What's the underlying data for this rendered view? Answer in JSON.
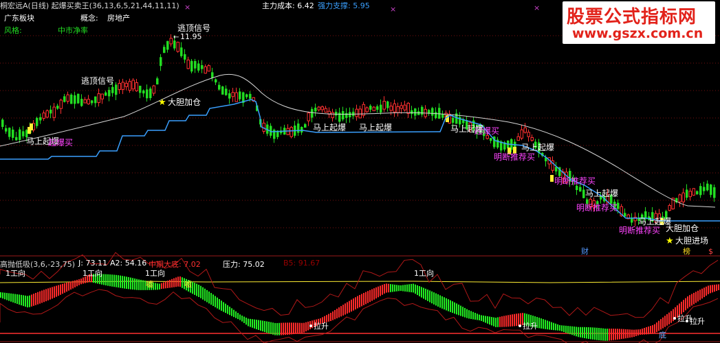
{
  "header": {
    "title": "桐宏远A(日线) 起爆买卖王(36,13,6,5,21,44,11,11)",
    "cost_label": "主力成本: 6.42",
    "support_label": "强力支撑: 5.95",
    "sector": "广东板块",
    "concept_label": "概念:",
    "concept_value": "房地产",
    "style_label": "风格:",
    "style_value": "中市净率"
  },
  "watermark": {
    "line1": "股票公式指标网",
    "line2": "www.gszx.com.cn"
  },
  "lower_header": {
    "name": "高抛低吸(3,6,-23,75)",
    "j": "J: 73.11",
    "a2": "A2: 54.16",
    "mid": "中期大底: 7.02",
    "pressure": "压力: 75.02",
    "b5": "B5: 91.67"
  },
  "colors": {
    "up": "#ff3030",
    "down": "#22dd22",
    "ma": "#d8d8d8",
    "support": "#3aa0ff",
    "label_white": "#ffffff",
    "label_magenta": "#ff44ff",
    "star": "#ffff00"
  },
  "chart_data": [
    {
      "type": "candlestick",
      "title": "起爆买卖王",
      "price_marker": "11.95",
      "annotations": [
        {
          "text": "逃顶信号",
          "color": "white"
        },
        {
          "text": "逃顶信号",
          "color": "white"
        },
        {
          "text": "大胆加仓",
          "color": "white",
          "star": true
        },
        {
          "text": "马上起爆",
          "color": "white"
        },
        {
          "text": "起爆买",
          "color": "magenta"
        },
        {
          "text": "马上起爆",
          "color": "white"
        },
        {
          "text": "马上起爆",
          "color": "white"
        },
        {
          "text": "马上起爆",
          "color": "white"
        },
        {
          "text": "起爆买",
          "color": "magenta"
        },
        {
          "text": "马上起爆",
          "color": "white"
        },
        {
          "text": "明断推荐买",
          "color": "magenta"
        },
        {
          "text": "明断推荐买",
          "color": "magenta"
        },
        {
          "text": "马上起爆",
          "color": "white"
        },
        {
          "text": "明断推荐买",
          "color": "magenta"
        },
        {
          "text": "马上起爆",
          "color": "white"
        },
        {
          "text": "明断推荐买",
          "color": "magenta"
        },
        {
          "text": "大胆加仓",
          "color": "white"
        },
        {
          "text": "大胆进场",
          "color": "white",
          "star": true
        }
      ],
      "bottom_markers": [
        "财",
        "榜",
        "$"
      ]
    },
    {
      "type": "bar",
      "title": "高抛低吸",
      "series": [
        {
          "name": "J"
        },
        {
          "name": "A2"
        },
        {
          "name": "压力"
        }
      ],
      "annotations": [
        "1工向",
        "1工向",
        "1工向",
        "1工向",
        "嘘",
        "嘘",
        "拉升",
        "拉升",
        "拉升",
        "拉升",
        "底"
      ]
    }
  ]
}
